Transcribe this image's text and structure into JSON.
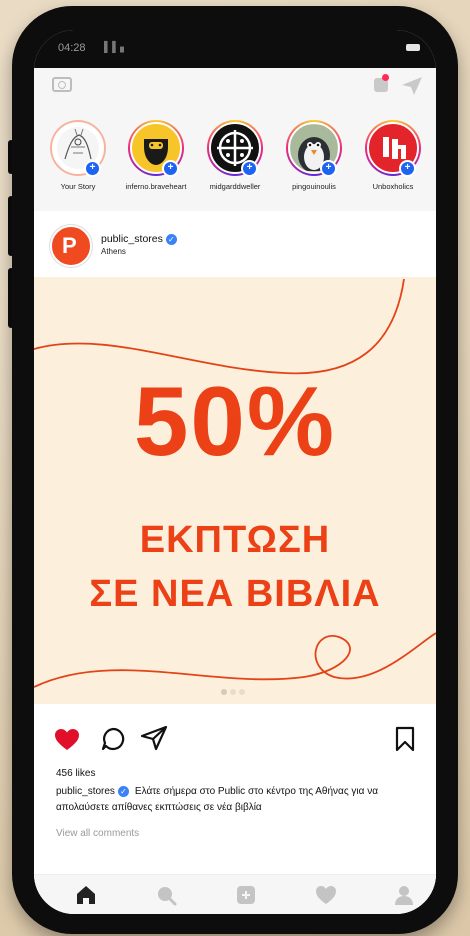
{
  "status_bar": {
    "time": "04:28",
    "signal": "▌▌▖"
  },
  "stories": [
    {
      "name": "Your Story"
    },
    {
      "name": "inferno.braveheart"
    },
    {
      "name": "midgarddweller"
    },
    {
      "name": "pingouinoulis"
    },
    {
      "name": "Unboxholics"
    }
  ],
  "post": {
    "username": "public_stores",
    "location": "Athens",
    "avatar_letter": "P",
    "image_text": {
      "headline": "50%",
      "line1": "ΕΚΠΤΩΣΗ",
      "line2": "ΣΕ ΝΕΑ ΒΙΒΛΙΑ"
    },
    "likes": "456 likes",
    "caption_user": "public_stores",
    "caption_text": "Ελάτε σήμερα στο Public στο κέντρο της Αθήνας για να απολαύσετε απίθανες εκπτώσεις σε νέα βιβλία",
    "view_comments": "View all comments",
    "carousel_index": 1,
    "carousel_count": 3
  },
  "colors": {
    "accent_orange": "#ec4016",
    "like_red": "#e0102b",
    "verified_blue": "#3b82f6",
    "story_plus": "#1d64f2",
    "image_bg": "#fcf0dd"
  },
  "icons": {
    "top_left": "camera-icon",
    "top_right": [
      "igtv-icon",
      "direct-send-icon"
    ],
    "actions": [
      "heart-filled-icon",
      "comment-icon",
      "share-icon",
      "bookmark-icon"
    ],
    "tabs": [
      "home-icon",
      "search-icon",
      "add-post-icon",
      "activity-heart-icon",
      "profile-icon"
    ]
  }
}
